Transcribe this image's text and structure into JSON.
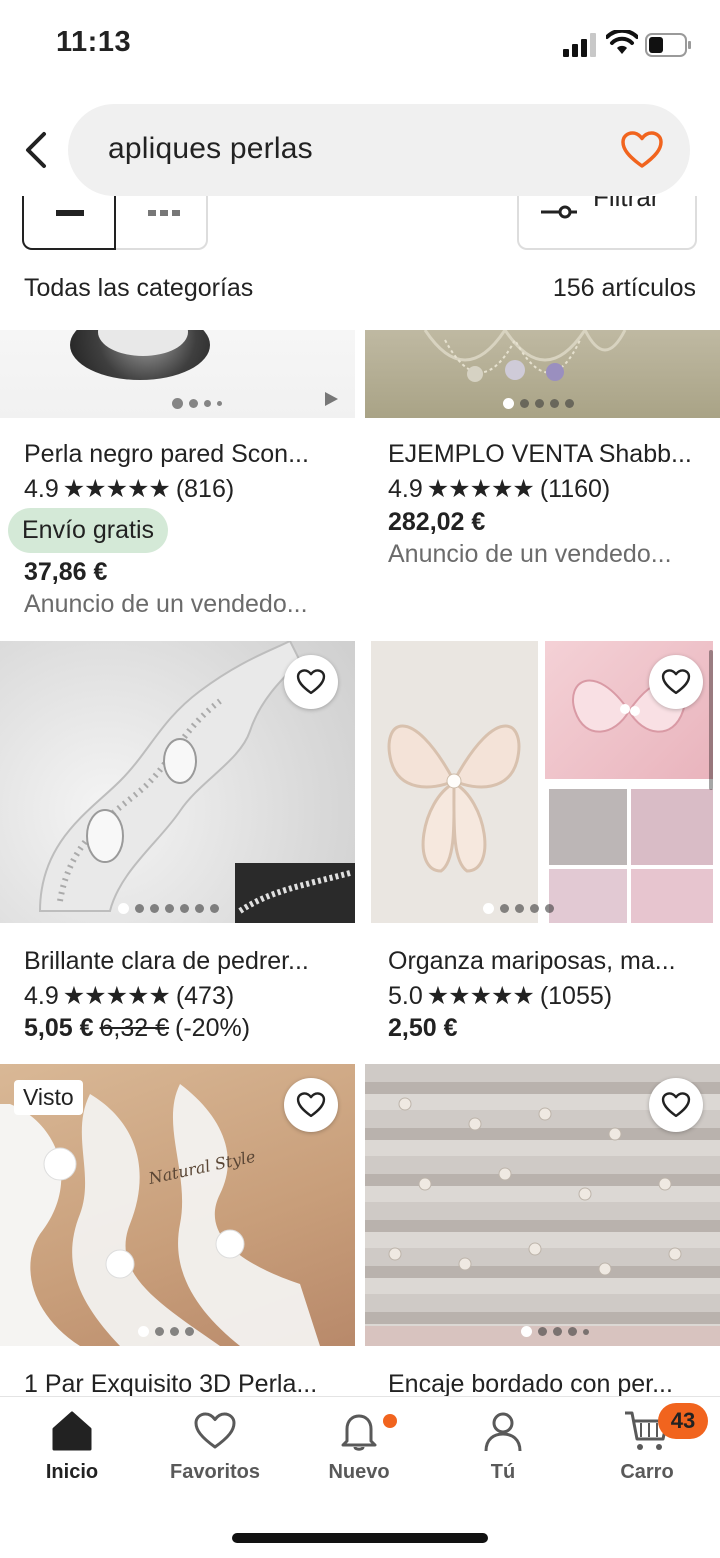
{
  "status_bar": {
    "time": "11:13"
  },
  "search": {
    "query": "apliques perlas"
  },
  "filter": {
    "label": "Filtrar"
  },
  "results": {
    "category": "Todas las categorías",
    "count": "156 artículos"
  },
  "listings": [
    {
      "title": "Perla negro pared Scon...",
      "rating": "4.9",
      "stars": "★★★★★",
      "reviews": "(816)",
      "badge": "Envío gratis",
      "price": "37,86 €",
      "ad": "Anuncio de un vendedo..."
    },
    {
      "title": "EJEMPLO VENTA Shabb...",
      "rating": "4.9",
      "stars": "★★★★★",
      "reviews": "(1160)",
      "price": "282,02 €",
      "ad": "Anuncio de un vendedo..."
    },
    {
      "title": "Brillante clara de pedrer...",
      "rating": "4.9",
      "stars": "★★★★★",
      "reviews": "(473)",
      "price": "5,05 €",
      "old_price": "6,32 €",
      "discount": "(-20%)"
    },
    {
      "title": "Organza mariposas, ma...",
      "rating": "5.0",
      "stars": "★★★★★",
      "reviews": "(1055)",
      "price": "2,50 €"
    },
    {
      "title": "1 Par Exquisito 3D Perla...",
      "tag": "Visto"
    },
    {
      "title": "Encaje bordado con per..."
    }
  ],
  "nav": {
    "items": [
      {
        "label": "Inicio",
        "icon": "home-icon"
      },
      {
        "label": "Favoritos",
        "icon": "heart-icon"
      },
      {
        "label": "Nuevo",
        "icon": "bell-icon"
      },
      {
        "label": "Tú",
        "icon": "person-icon"
      },
      {
        "label": "Carro",
        "icon": "cart-icon"
      }
    ],
    "cart_count": "43"
  },
  "colors": {
    "accent": "#f1641e",
    "free_shipping_bg": "#d4e9d7"
  }
}
